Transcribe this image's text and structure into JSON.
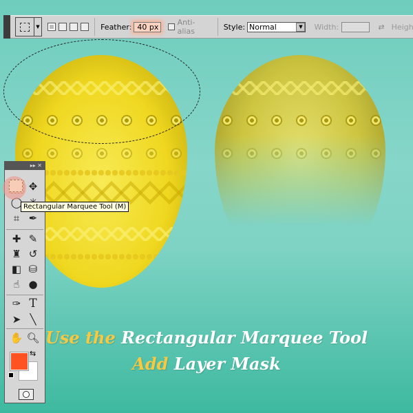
{
  "options_bar": {
    "feather_label": "Feather:",
    "feather_value": "40 px",
    "anti_alias_label": "Anti-alias",
    "anti_alias_checked": false,
    "style_label": "Style:",
    "style_value": "Normal",
    "width_label": "Width:",
    "width_value": "",
    "height_label": "Height",
    "tool_preset_icon": "rectangular-marquee-icon"
  },
  "tools_panel": {
    "header_icons": [
      "collapse-icon",
      "close-icon"
    ],
    "active_tool": "Rectangular Marquee Tool",
    "tooltip": "Rectangular Marquee Tool (M)",
    "type_tool_glyph": "T",
    "foreground_color": "#ff5222",
    "background_color": "#ffffff"
  },
  "caption": {
    "line1_highlight": "Use the",
    "line1_rest": "Rectangular Marquee Tool",
    "line2_highlight": "Add",
    "line2_rest": "Layer Mask"
  },
  "colors": {
    "highlight": "#f7c842",
    "egg": "#f0d820"
  }
}
